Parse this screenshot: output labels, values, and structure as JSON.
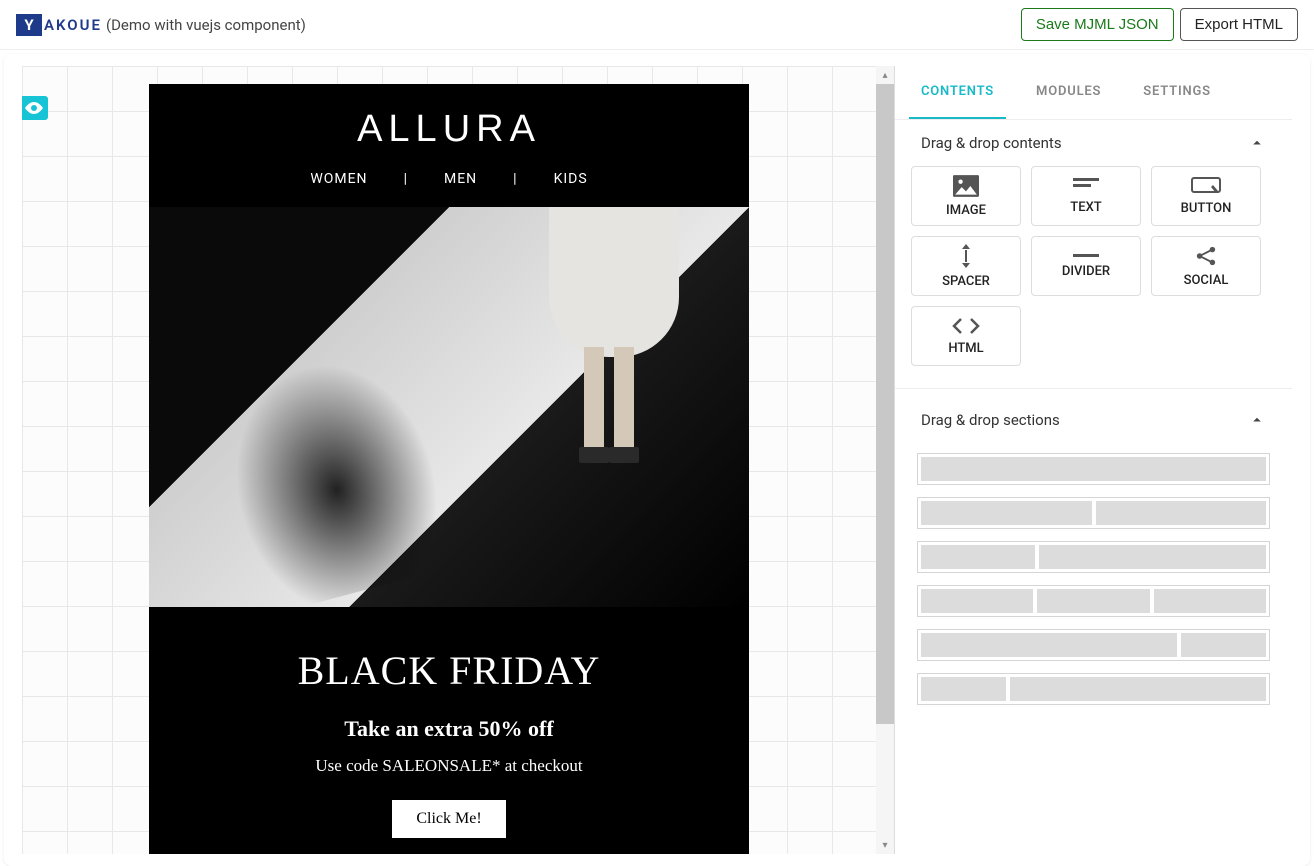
{
  "brand": {
    "icon_letter": "Y",
    "name": "AKOUE",
    "tagline": "(Demo with vuejs component)"
  },
  "actions": {
    "save": "Save MJML JSON",
    "export": "Export HTML"
  },
  "email": {
    "brand": "ALLURA",
    "nav": [
      "WOMEN",
      "|",
      "MEN",
      "|",
      "KIDS"
    ],
    "promo_title": "BLACK FRIDAY",
    "promo_sub": "Take an  extra 50% off",
    "promo_code": "Use code SALEONSALE* at checkout",
    "cta": "Click Me!"
  },
  "sidebar": {
    "tabs": {
      "contents": "CONTENTS",
      "modules": "MODULES",
      "settings": "SETTINGS"
    },
    "section_contents": "Drag & drop contents",
    "section_sections": "Drag & drop sections",
    "blocks": {
      "image": "IMAGE",
      "text": "TEXT",
      "button": "BUTTON",
      "spacer": "SPACER",
      "divider": "DIVIDER",
      "social": "SOCIAL",
      "html": "HTML"
    }
  }
}
